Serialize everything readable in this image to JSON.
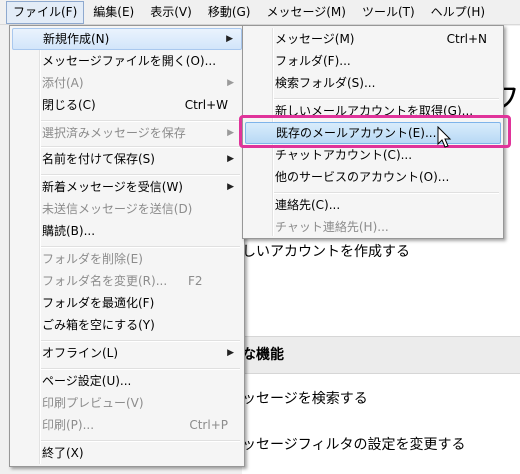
{
  "menubar": {
    "items": [
      {
        "label": "ファイル(F)"
      },
      {
        "label": "編集(E)"
      },
      {
        "label": "表示(V)"
      },
      {
        "label": "移動(G)"
      },
      {
        "label": "メッセージ(M)"
      },
      {
        "label": "ツール(T)"
      },
      {
        "label": "ヘルプ(H)"
      }
    ]
  },
  "background_page": {
    "title_char": "フ",
    "line1": "しいアカウントを作成する",
    "heading": "な機能",
    "line2": "ッセージを検索する",
    "line3": "ッセージフィルタの設定を変更する"
  },
  "file_menu": {
    "items": [
      {
        "label": "新規作成(N)",
        "submenu": true
      },
      {
        "label": "メッセージファイルを開く(O)..."
      },
      {
        "label": "添付(A)",
        "disabled": true,
        "submenu": true
      },
      {
        "label": "閉じる(C)",
        "shortcut": "Ctrl+W"
      },
      {
        "label": "選択済みメッセージを保存",
        "disabled": true,
        "submenu": true
      },
      {
        "label": "名前を付けて保存(S)",
        "submenu": true
      },
      {
        "label": "新着メッセージを受信(W)",
        "submenu": true
      },
      {
        "label": "未送信メッセージを送信(D)",
        "disabled": true
      },
      {
        "label": "購読(B)..."
      },
      {
        "label": "フォルダを削除(E)",
        "disabled": true
      },
      {
        "label": "フォルダ名を変更(R)...",
        "disabled": true,
        "shortcut": "F2"
      },
      {
        "label": "フォルダを最適化(F)"
      },
      {
        "label": "ごみ箱を空にする(Y)"
      },
      {
        "label": "オフライン(L)",
        "submenu": true
      },
      {
        "label": "ページ設定(U)..."
      },
      {
        "label": "印刷プレビュー(V)",
        "disabled": true
      },
      {
        "label": "印刷(P)...",
        "disabled": true,
        "shortcut": "Ctrl+P"
      },
      {
        "label": "終了(X)"
      }
    ]
  },
  "new_submenu": {
    "items": [
      {
        "label": "メッセージ(M)",
        "shortcut": "Ctrl+N"
      },
      {
        "label": "フォルダ(F)..."
      },
      {
        "label": "検索フォルダ(S)..."
      },
      {
        "label": "新しいメールアカウントを取得(G)..."
      },
      {
        "label": "既存のメールアカウント(E)..."
      },
      {
        "label": "チャットアカウント(C)..."
      },
      {
        "label": "他のサービスのアカウント(O)..."
      },
      {
        "label": "連絡先(C)..."
      },
      {
        "label": "チャット連絡先(H)...",
        "disabled": true
      }
    ]
  },
  "colors": {
    "highlight_box": "#e0339a"
  },
  "icons": {
    "submenu_arrow": "arrow-right-icon",
    "cursor": "mouse-pointer-icon"
  }
}
